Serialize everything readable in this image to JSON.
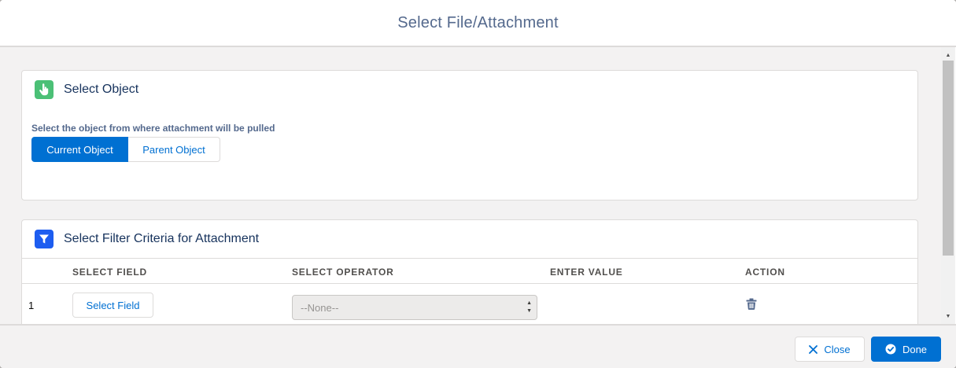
{
  "modal": {
    "title": "Select File/Attachment"
  },
  "select_object": {
    "title": "Select Object",
    "help_text": "Select the object from where attachment will be pulled",
    "options": [
      "Current Object",
      "Parent Object"
    ],
    "selected": "Current Object"
  },
  "filter": {
    "title": "Select Filter Criteria for Attachment",
    "columns": [
      "SELECT FIELD",
      "SELECT OPERATOR",
      "ENTER VALUE",
      "ACTION"
    ],
    "rows": [
      {
        "index": "1",
        "field_button": "Select Field",
        "operator": "--None--"
      }
    ]
  },
  "footer": {
    "close_label": "Close",
    "done_label": "Done"
  },
  "icons": {
    "select_object": "hand-pointer-icon",
    "filter": "filter-icon",
    "delete": "trash-icon",
    "close": "close-icon",
    "done": "check-circle-icon"
  },
  "colors": {
    "brand": "#0070d2",
    "green_icon": "#4bc076",
    "blue_icon": "#1d5df0"
  }
}
